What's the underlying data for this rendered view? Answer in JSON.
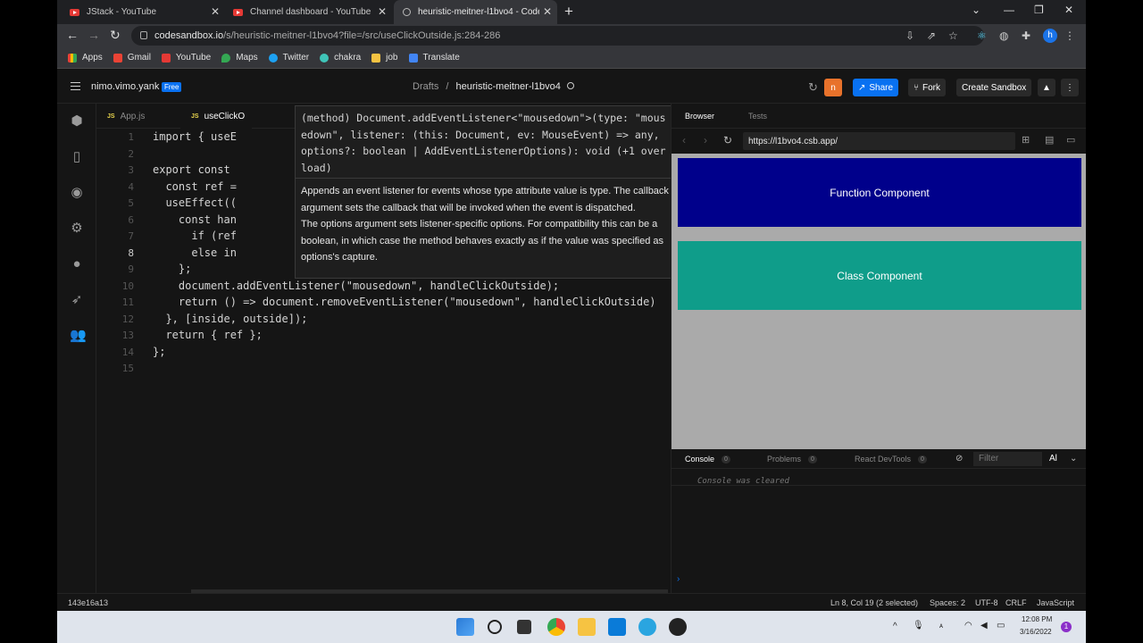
{
  "browser": {
    "tabs": [
      {
        "title": "JStack - YouTube"
      },
      {
        "title": "Channel dashboard - YouTube St"
      },
      {
        "title": "heuristic-meitner-l1bvo4 - Code"
      }
    ],
    "url_host": "codesandbox.io",
    "url_path": "/s/heuristic-meitner-l1bvo4?file=/src/useClickOutside.js:284-286",
    "profile_initial": "h",
    "bookmarks": [
      "Apps",
      "Gmail",
      "YouTube",
      "Maps",
      "Twitter",
      "chakra",
      "job",
      "Translate"
    ]
  },
  "csb": {
    "username": "nimo.vimo.yank",
    "plan_badge": "Free",
    "crumb_drafts": "Drafts",
    "crumb_sep": "/",
    "sandbox_name": "heuristic-meitner-l1bvo4",
    "avatar_initial": "n",
    "share_label": "Share",
    "fork_label": "Fork",
    "create_label": "Create Sandbox"
  },
  "editor": {
    "tabs": [
      {
        "label": "App.js",
        "lang": "JS"
      },
      {
        "label": "useClickO",
        "lang": "JS"
      }
    ],
    "line_numbers": [
      "1",
      "2",
      "3",
      "4",
      "5",
      "6",
      "7",
      "8",
      "9",
      "10",
      "11",
      "12",
      "13",
      "14",
      "15"
    ],
    "lines": [
      "import { useE",
      "",
      "export const",
      "  const ref =",
      "  useEffect((",
      "    const han",
      "      if (ref",
      "      else in",
      "    };",
      "    document.addEventListener(\"mousedown\", handleClickOutside);",
      "    return () => document.removeEventListener(\"mousedown\", handleClickOutside)",
      "  }, [inside, outside]);",
      "  return { ref };",
      "};",
      ""
    ]
  },
  "tooltip": {
    "signature": "(method) Document.addEventListener<\"mousedown\">(type: \"mousedown\", listener: (this: Document, ev: MouseEvent) => any, options?: boolean | AddEventListenerOptions): void (+1 overload)",
    "doc1": "Appends an event listener for events whose type attribute value is type. The callback argument sets the callback that will be invoked when the event is dispatched.",
    "doc2": "The options argument sets listener-specific options. For compatibility this can be a boolean, in which case the method behaves exactly as if the value was specified as options's capture."
  },
  "preview": {
    "tab_browser": "Browser",
    "tab_tests": "Tests",
    "url": "https://l1bvo4.csb.app/",
    "function_component": "Function Component",
    "class_component": "Class Component",
    "function_color": "#00008b",
    "class_color": "#0f9d8a"
  },
  "console": {
    "tabs": [
      {
        "label": "Console",
        "count": "0"
      },
      {
        "label": "Problems",
        "count": "0"
      },
      {
        "label": "React DevTools",
        "count": "0"
      }
    ],
    "filter_placeholder": "Filter",
    "level": "Al",
    "message": "Console was cleared"
  },
  "status": {
    "commit": "143e16a13",
    "position": "Ln 8, Col 19 (2 selected)",
    "spaces": "Spaces: 2",
    "encoding": "UTF-8",
    "eol": "CRLF",
    "language": "JavaScript"
  },
  "taskbar": {
    "time": "12:08 PM",
    "date": "3/16/2022",
    "notif_count": "1"
  }
}
